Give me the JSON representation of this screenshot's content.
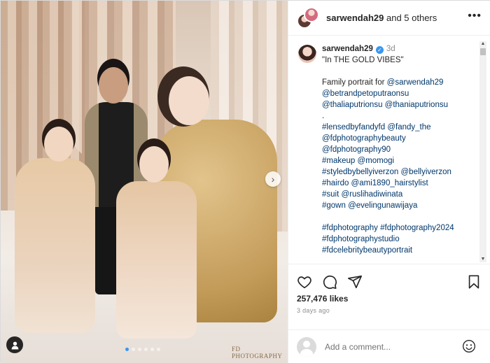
{
  "post": {
    "photo_watermark": "FD PHOTOGRAPHY",
    "carousel": {
      "total": 6,
      "active_index": 0
    }
  },
  "header": {
    "username": "sarwendah29",
    "others_text": " and 5 others",
    "more_glyph": "•••"
  },
  "caption": {
    "username": "sarwendah29",
    "verified_glyph": "✓",
    "time": "3d",
    "lines": [
      {
        "text": "\"In THE GOLD VIBES\"",
        "style": "plain"
      },
      {
        "text": "",
        "style": "gap"
      },
      {
        "text": "Family portrait for ",
        "style": "plain",
        "mention": "@sarwendah29"
      },
      {
        "text": "@betrandpetoputraonsu",
        "style": "blue"
      },
      {
        "text": "@thaliaputrionsu @thaniaputrionsu",
        "style": "blue"
      },
      {
        "text": ".",
        "style": "plain"
      },
      {
        "text": "#lensedbyfandyfd @fandy_the",
        "style": "blue"
      },
      {
        "text": "@fdphotographybeauty",
        "style": "blue"
      },
      {
        "text": "@fdphotography90",
        "style": "blue"
      },
      {
        "text": "#makeup @momogi",
        "style": "blue"
      },
      {
        "text": "#styledbybellyiverzon @bellyiverzon",
        "style": "blue"
      },
      {
        "text": "#hairdo @ami1890_hairstylist",
        "style": "blue"
      },
      {
        "text": "#suit @ruslihadiwinata",
        "style": "blue"
      },
      {
        "text": "#gown @evelingunawijaya",
        "style": "blue"
      },
      {
        "text": "",
        "style": "gap"
      },
      {
        "text": "#fdphotography #fdphotography2024",
        "style": "blue"
      },
      {
        "text": "#fdphotographystudio",
        "style": "blue"
      },
      {
        "text": "#fdcelebritybeautyportrait",
        "style": "blue"
      }
    ]
  },
  "actions": {
    "likes": "257,476 likes",
    "time_ago": "3 days ago",
    "icons": [
      "heart-icon",
      "comment-icon",
      "share-icon",
      "bookmark-icon"
    ]
  },
  "comment": {
    "placeholder": "Add a comment...",
    "emoji_icon": "smiley-icon"
  },
  "colors": {
    "link": "#00376b",
    "verified": "#3897f0",
    "carousel_active": "#3797f0"
  }
}
